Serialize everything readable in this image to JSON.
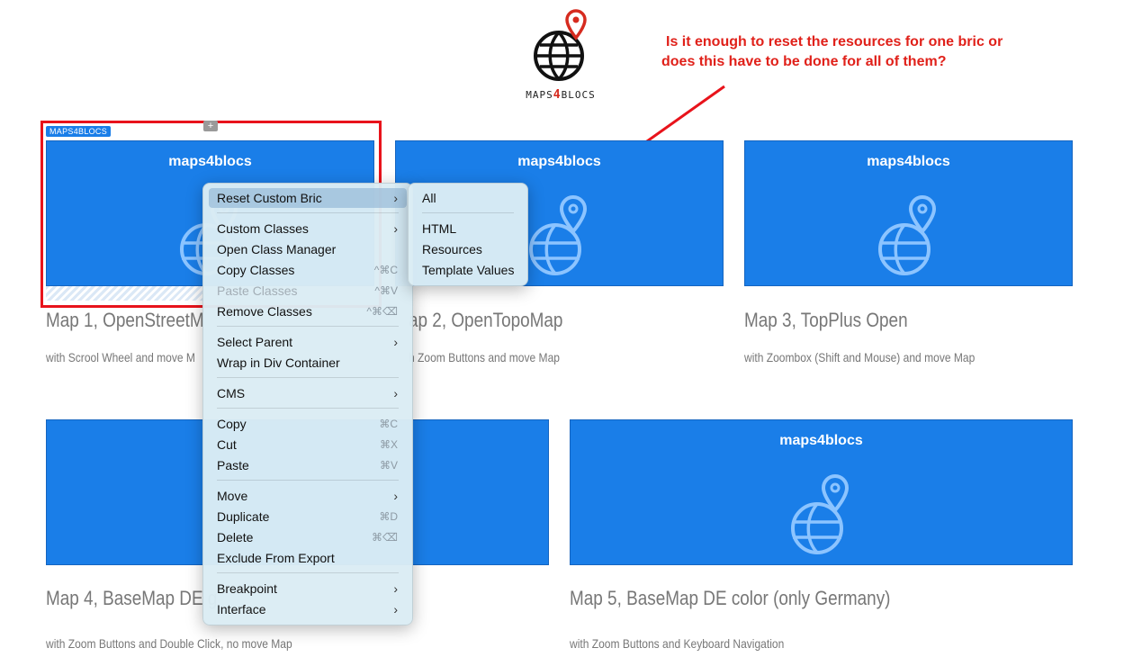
{
  "logo": {
    "text_pre": "MAPS",
    "text_four": "4",
    "text_post": "BLOCS"
  },
  "annotation": {
    "line1": "Is it enough to reset the resources for one bric or",
    "line2": "does this have to be done for all of them?",
    "color": "#e0211a"
  },
  "selected_bric": {
    "label": "MAPS4BLOCS",
    "plus": "+"
  },
  "cards": [
    {
      "title": "maps4blocs"
    },
    {
      "title": "maps4blocs"
    },
    {
      "title": "maps4blocs"
    },
    {
      "title": ""
    },
    {
      "title": "maps4blocs"
    }
  ],
  "maps": [
    {
      "title": "Map 1, OpenStreetM",
      "subtitle": "with Scrool Wheel and move M"
    },
    {
      "title": "ap 2, OpenTopoMap",
      "subtitle": "h Zoom Buttons and move Map"
    },
    {
      "title": "Map 3, TopPlus Open",
      "subtitle": "with Zoombox (Shift and Mouse) and move Map"
    },
    {
      "title": "Map 4, BaseMap DE g",
      "subtitle": "with Zoom Buttons and Double Click, no move Map"
    },
    {
      "title": "Map 5, BaseMap DE color (only Germany)",
      "subtitle": "with Zoom Buttons and Keyboard Navigation"
    }
  ],
  "context_menu": {
    "items": [
      {
        "label": "Reset Custom Bric",
        "submenu": true,
        "highlighted": true
      },
      {
        "label": "Custom Classes",
        "submenu": true
      },
      {
        "label": "Open Class Manager"
      },
      {
        "label": "Copy Classes",
        "shortcut": "^⌘C"
      },
      {
        "label": "Paste Classes",
        "shortcut": "^⌘V",
        "disabled": true
      },
      {
        "label": "Remove Classes",
        "shortcut": "^⌘⌫"
      },
      {
        "label": "Select Parent",
        "submenu": true
      },
      {
        "label": "Wrap in Div Container"
      },
      {
        "label": "CMS",
        "submenu": true
      },
      {
        "label": "Copy",
        "shortcut": "⌘C"
      },
      {
        "label": "Cut",
        "shortcut": "⌘X"
      },
      {
        "label": "Paste",
        "shortcut": "⌘V"
      },
      {
        "label": "Move",
        "submenu": true
      },
      {
        "label": "Duplicate",
        "shortcut": "⌘D"
      },
      {
        "label": "Delete",
        "shortcut": "⌘⌫"
      },
      {
        "label": "Exclude From Export"
      },
      {
        "label": "Breakpoint",
        "submenu": true
      },
      {
        "label": "Interface",
        "submenu": true
      }
    ],
    "chevron": "›"
  },
  "submenu": {
    "items": [
      {
        "label": "All"
      },
      {
        "label": "HTML"
      },
      {
        "label": "Resources"
      },
      {
        "label": "Template Values"
      }
    ]
  },
  "colors": {
    "card_blue": "#1a7ee8",
    "selection_red": "#e8131b",
    "pin_red": "#d62b1f"
  }
}
